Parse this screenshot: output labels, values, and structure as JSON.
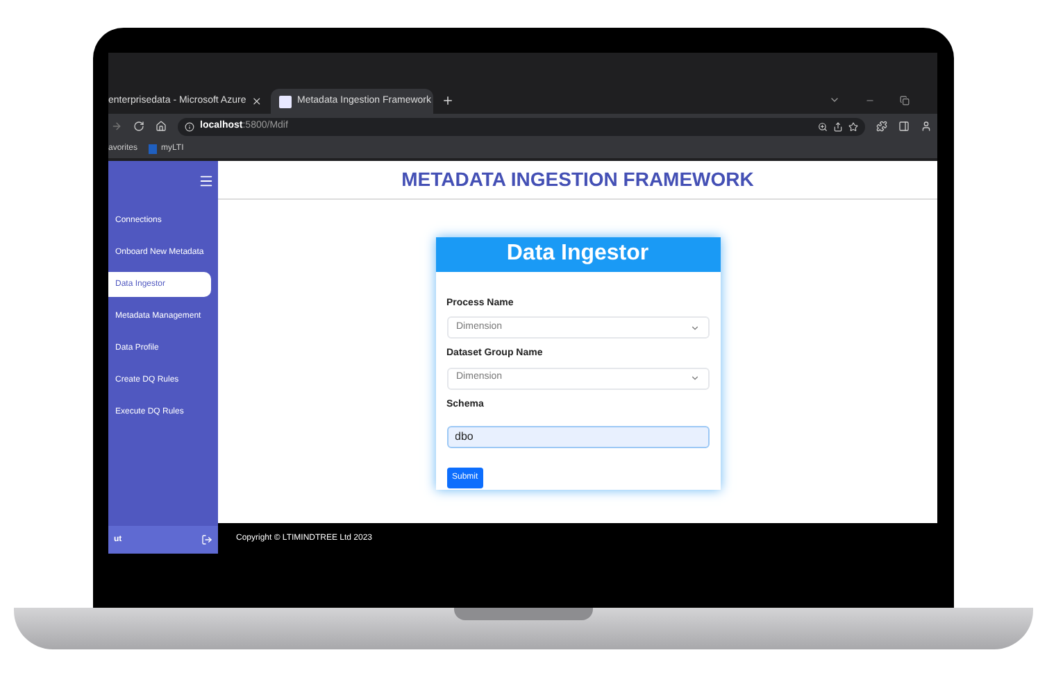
{
  "browser": {
    "tabs": [
      {
        "title": "enterprisedata - Microsoft Azure",
        "selected": false
      },
      {
        "title": "Metadata Ingestion Framework",
        "selected": true
      }
    ],
    "address": {
      "host": "localhost",
      "path": ":5800/Mdif"
    },
    "bookmarks": [
      {
        "label": "avorites",
        "kind": "folder"
      },
      {
        "label": "myLTI",
        "kind": "link"
      }
    ]
  },
  "app": {
    "title": "METADATA INGESTION FRAMEWORK",
    "sidebar": {
      "items": [
        {
          "label": "Connections",
          "selected": false
        },
        {
          "label": "Onboard New Metadata",
          "selected": false
        },
        {
          "label": "Data Ingestor",
          "selected": true
        },
        {
          "label": "Metadata Management",
          "selected": false
        },
        {
          "label": "Data Profile",
          "selected": false
        },
        {
          "label": "Create DQ Rules",
          "selected": false
        },
        {
          "label": "Execute DQ Rules",
          "selected": false
        }
      ],
      "footer_label": "ut"
    },
    "form": {
      "title": "Data Ingestor",
      "fields": [
        {
          "label": "Process Name",
          "kind": "select",
          "value": "Dimension"
        },
        {
          "label": "Dataset Group Name",
          "kind": "select",
          "value": "Dimension"
        },
        {
          "label": "Schema",
          "kind": "text",
          "value": "dbo"
        }
      ],
      "submit": "Submit"
    },
    "footer": "Copyright © LTIMINDTREE Ltd 2023"
  }
}
